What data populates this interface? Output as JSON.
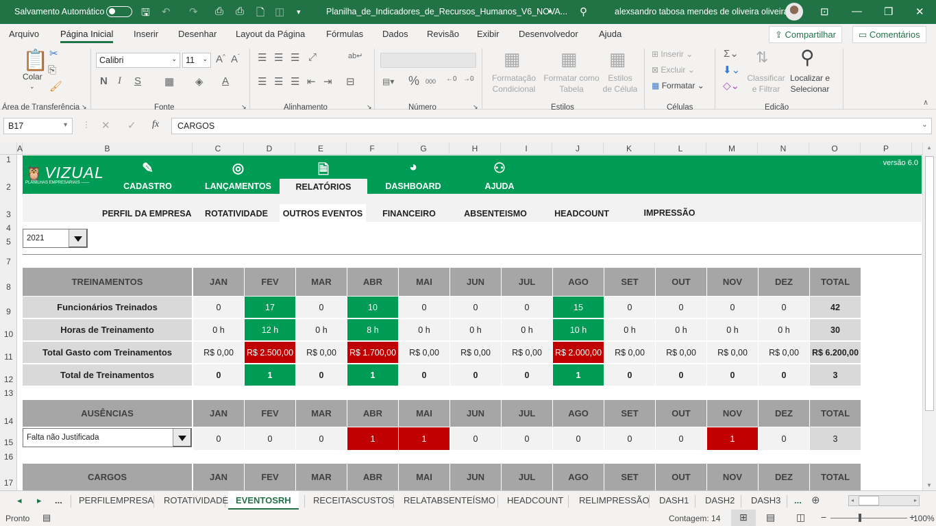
{
  "titlebar": {
    "autosave_label": "Salvamento Automático",
    "filename": "Planilha_de_Indicadores_de_Recursos_Humanos_V6_NOVA...",
    "user": "alexsandro tabosa mendes de oliveira oliveira"
  },
  "ribbon": {
    "tabs": [
      "Arquivo",
      "Página Inicial",
      "Inserir",
      "Desenhar",
      "Layout da Página",
      "Fórmulas",
      "Dados",
      "Revisão",
      "Exibir",
      "Desenvolvedor",
      "Ajuda"
    ],
    "active_tab": "Página Inicial",
    "share": "Compartilhar",
    "comments": "Comentários",
    "clipboard": {
      "paste": "Colar",
      "group": "Área de Transferência"
    },
    "font": {
      "name": "Calibri",
      "size": "11",
      "bold": "N",
      "italic": "I",
      "underline": "S",
      "group": "Fonte"
    },
    "alignment": {
      "group": "Alinhamento"
    },
    "number": {
      "group": "Número",
      "percent": "%",
      "thousands": "000"
    },
    "styles": {
      "conditional": "Formatação Condicional",
      "as_table": "Formatar como Tabela",
      "cell_styles": "Estilos de Célula",
      "group": "Estilos"
    },
    "cells": {
      "insert": "Inserir",
      "delete": "Excluir",
      "format": "Formatar",
      "group": "Células"
    },
    "editing": {
      "sort_filter": "Classificar e Filtrar",
      "find_select": "Localizar e Selecionar",
      "group": "Edição"
    }
  },
  "formula_bar": {
    "name_box": "B17",
    "fx": "fx",
    "content": "CARGOS"
  },
  "columns": [
    "A",
    "B",
    "C",
    "D",
    "E",
    "F",
    "G",
    "H",
    "I",
    "J",
    "K",
    "L",
    "M",
    "N",
    "O",
    "P"
  ],
  "rows": [
    "1",
    "2",
    "3",
    "4",
    "5",
    "7",
    "8",
    "9",
    "10",
    "11",
    "12",
    "13",
    "14",
    "15",
    "16",
    "17"
  ],
  "sheet": {
    "logo": "VIZUAL",
    "logo_sub": "PLANILHAS EMPRESARIAIS",
    "version": "versão 6.0",
    "nav": [
      {
        "label": "CADASTRO",
        "icon": "pencil-icon"
      },
      {
        "label": "LANÇAMENTOS",
        "icon": "target-icon"
      },
      {
        "label": "RELATÓRIOS",
        "icon": "document-icon"
      },
      {
        "label": "DASHBOARD",
        "icon": "pie-chart-icon"
      },
      {
        "label": "AJUDA",
        "icon": "help-people-icon"
      }
    ],
    "active_nav": "RELATÓRIOS",
    "subnav": [
      "PERFIL DA EMPRESA",
      "ROTATIVIDADE",
      "OUTROS EVENTOS",
      "FINANCEIRO",
      "ABSENTEISMO",
      "HEADCOUNT",
      "IMPRESSÃO"
    ],
    "active_subnav": "OUTROS EVENTOS",
    "year": "2021",
    "months": [
      "JAN",
      "FEV",
      "MAR",
      "ABR",
      "MAI",
      "JUN",
      "JUL",
      "AGO",
      "SET",
      "OUT",
      "NOV",
      "DEZ"
    ],
    "total_label": "TOTAL",
    "treinamentos": {
      "title": "TREINAMENTOS",
      "rows": [
        {
          "label": "Funcionários Treinados",
          "values": [
            "0",
            "17",
            "0",
            "10",
            "0",
            "0",
            "0",
            "15",
            "0",
            "0",
            "0",
            "0"
          ],
          "total": "42"
        },
        {
          "label": "Horas de Treinamento",
          "values": [
            "0 h",
            "12 h",
            "0 h",
            "8 h",
            "0 h",
            "0 h",
            "0 h",
            "10 h",
            "0 h",
            "0 h",
            "0 h",
            "0 h"
          ],
          "total": "30"
        },
        {
          "label": "Total Gasto com Treinamentos",
          "values": [
            "R$ 0,00",
            "R$ 2.500,00",
            "R$ 0,00",
            "R$ 1.700,00",
            "R$ 0,00",
            "R$ 0,00",
            "R$ 0,00",
            "R$ 2.000,00",
            "R$ 0,00",
            "R$ 0,00",
            "R$ 0,00",
            "R$ 0,00"
          ],
          "total": "R$ 6.200,00"
        },
        {
          "label": "Total de Treinamentos",
          "values": [
            "0",
            "1",
            "0",
            "1",
            "0",
            "0",
            "0",
            "1",
            "0",
            "0",
            "0",
            "0"
          ],
          "total": "3"
        }
      ]
    },
    "ausencias": {
      "title": "AUSÊNCIAS",
      "selected": "Falta não Justificada",
      "values": [
        "0",
        "0",
        "0",
        "1",
        "1",
        "0",
        "0",
        "0",
        "0",
        "0",
        "1",
        "0"
      ],
      "total": "3"
    },
    "cargos": {
      "title": "CARGOS"
    },
    "colors": {
      "green": "#009b55",
      "red": "#c00000",
      "header_gray": "#a6a6a6"
    }
  },
  "sheet_tabs": [
    "PERFILEMPRESA",
    "ROTATIVIDADE",
    "EVENTOSRH",
    "RECEITASCUSTOS",
    "RELATABSENTEÍSMO",
    "HEADCOUNT",
    "RELIMPRESSÃO",
    "DASH1",
    "DASH2",
    "DASH3"
  ],
  "active_sheet": "EVENTOSRH",
  "status": {
    "ready": "Pronto",
    "count": "Contagem: 14",
    "zoom": "100%"
  }
}
